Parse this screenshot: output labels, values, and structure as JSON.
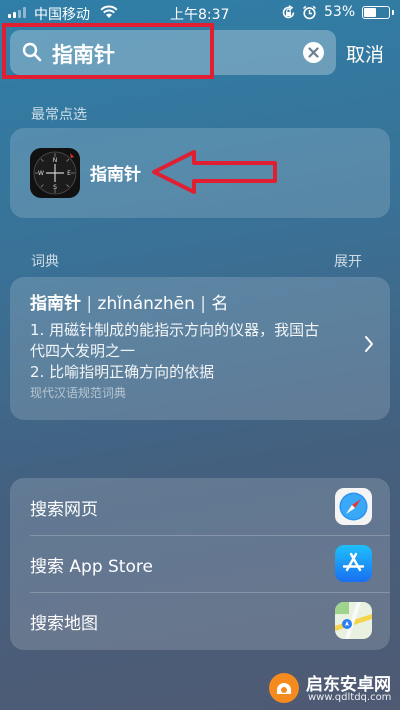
{
  "status_bar": {
    "carrier": "中国移动",
    "time": "上午8:37",
    "battery_percent_text": "53%",
    "battery_level": 0.53
  },
  "search": {
    "query": "指南针",
    "cancel_label": "取消"
  },
  "top_hits": {
    "title": "最常点选",
    "app_name": "指南针",
    "app_icon": "compass-app-icon"
  },
  "dictionary": {
    "title": "词典",
    "expand_label": "展开",
    "headword": "指南针",
    "pinyin": "zhǐnánzhēn",
    "part_of_speech": "名",
    "definition_1a": "1. 用磁针制成的能指示方向的仪器，我国古",
    "definition_1b": "代四大发明之一",
    "definition_2": "2. 比喻指明正确方向的依据",
    "source": "现代汉语规范词典"
  },
  "search_options": [
    {
      "label": "搜索网页",
      "icon": "safari-icon"
    },
    {
      "label": "搜索 App Store",
      "icon": "app-store-icon"
    },
    {
      "label": "搜索地图",
      "icon": "maps-icon"
    }
  ],
  "watermark": {
    "name": "启东安卓网",
    "url": "www.qdltdq.com"
  },
  "colors": {
    "annotation_red": "#e02032",
    "app_store_blue": "#1a8cf5"
  }
}
